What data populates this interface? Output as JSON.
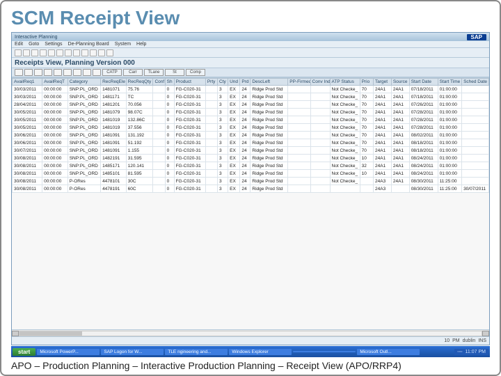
{
  "slide": {
    "title": "SCM Receipt View",
    "caption": "APO – Production Planning – Interactive Production Planning – Receipt View (APO/RRP4)"
  },
  "sap": {
    "titlebar": "Interactive Planning",
    "logo": "SAP",
    "menu": [
      "Edit",
      "Goto",
      "Settings",
      "De-Planning Board",
      "System",
      "Help"
    ],
    "view_title": "Receipts View, Planning Version 000",
    "toolbar2_labels": [
      "",
      "",
      "",
      "",
      "",
      "",
      "",
      "",
      "",
      "CATP",
      "Carr",
      "TLane",
      "St",
      "Comp"
    ],
    "status_right": [
      "10",
      "PM",
      "dublin",
      "INS"
    ]
  },
  "grid": {
    "columns": [
      "AvailReq1",
      "AvailReqT",
      "Category",
      "RecReqEle",
      "RecReqQty",
      "Conf",
      "Sh",
      "Product",
      "Prty",
      "Cty",
      "Und",
      "Prd",
      "DescLeft",
      "PP-Firmed",
      "Conv Ind",
      "ATP Status",
      "Prio",
      "Target",
      "Source",
      "Start Date",
      "Start Time",
      "Sched Date"
    ],
    "rows": [
      {
        "c": [
          "30/03/2011",
          "00:00:00",
          "SNP:PL_ORD",
          "1481071",
          "75.76",
          "",
          "0",
          "FG-C020-31",
          "",
          "3",
          "EX",
          "24",
          "Ridge Prod Std",
          "",
          "",
          "Not Checke_",
          "70",
          "24A1",
          "24A1",
          "07/18/2011",
          "01:00:00",
          ""
        ]
      },
      {
        "c": [
          "30/03/2011",
          "00:00:00",
          "SNP:PL_ORD",
          "1481171",
          "TC",
          "",
          "0",
          "FG-C020-31",
          "",
          "3",
          "EX",
          "24",
          "Ridge Prod Std",
          "",
          "",
          "Not Checke_",
          "70",
          "24A1",
          "24A1",
          "07/18/2011",
          "01:00:00",
          ""
        ]
      },
      {
        "c": [
          "28/04/2011",
          "00:00:00",
          "SNP:PL_ORD",
          "1481201",
          "70.056",
          "",
          "0",
          "FG-C020-31",
          "",
          "3",
          "EX",
          "24",
          "Ridge Prod Std",
          "",
          "",
          "Not Checke_",
          "70",
          "24A1",
          "24A1",
          "07/26/2011",
          "01:00:00",
          ""
        ]
      },
      {
        "c": [
          "30/05/2011",
          "00:00:00",
          "SNP:PL_ORD",
          "1481079",
          "98.07C",
          "",
          "0",
          "FG-C020-31",
          "",
          "3",
          "EX",
          "24",
          "Ridge Prod Std",
          "",
          "",
          "Not Checke_",
          "70",
          "24A1",
          "24A1",
          "07/28/2011",
          "01:00:00",
          ""
        ]
      },
      {
        "c": [
          "30/05/2011",
          "00:00:00",
          "SNP:PL_ORD",
          "1481019",
          "132.86C",
          "",
          "0",
          "FG-C020-31",
          "",
          "3",
          "EX",
          "24",
          "Ridge Prod Std",
          "",
          "",
          "Not Checke_",
          "70",
          "24A1",
          "24A1",
          "07/28/2011",
          "01:00:00",
          ""
        ]
      },
      {
        "c": [
          "30/05/2011",
          "00:00:00",
          "SNP:PL_ORD",
          "1481019",
          "37.556",
          "",
          "0",
          "FG-C020-31",
          "",
          "3",
          "EX",
          "24",
          "Ridge Prod Std",
          "",
          "",
          "Not Checke_",
          "70",
          "24A1",
          "24A1",
          "07/28/2011",
          "01:00:00",
          ""
        ]
      },
      {
        "c": [
          "30/06/2011",
          "00:00:00",
          "SNP:PL_ORD",
          "1481091",
          "131.192",
          "",
          "0",
          "FG-C020-31",
          "",
          "3",
          "EX",
          "24",
          "Ridge Prod Std",
          "",
          "",
          "Not Checke_",
          "70",
          "24A1",
          "24A1",
          "08/02/2011",
          "01:00:00",
          ""
        ]
      },
      {
        "c": [
          "30/06/2011",
          "00:00:00",
          "SNP:PL_ORD",
          "1481091",
          "51.192",
          "",
          "0",
          "FG-C020-31",
          "",
          "3",
          "EX",
          "24",
          "Ridge Prod Std",
          "",
          "",
          "Not Checke_",
          "70",
          "24A1",
          "24A1",
          "08/18/2011",
          "01:00:00",
          ""
        ]
      },
      {
        "c": [
          "30/07/2011",
          "00:00:00",
          "SNP:PL_ORD",
          "1481091",
          "1.155",
          "",
          "0",
          "FG-C020-31",
          "",
          "3",
          "EX",
          "24",
          "Ridge Prod Std",
          "",
          "",
          "Not Checke_",
          "70",
          "24A1",
          "24A1",
          "08/18/2011",
          "01:00:00",
          ""
        ]
      },
      {
        "c": [
          "30/08/2011",
          "00:00:00",
          "SNP:PL_ORD",
          "1482191",
          "31.595",
          "",
          "0",
          "FG-C020-31",
          "",
          "3",
          "EX",
          "24",
          "Ridge Prod Std",
          "",
          "",
          "Not Checke_",
          "10",
          "24A1",
          "24A1",
          "08/24/2011",
          "01:00:00",
          ""
        ]
      },
      {
        "c": [
          "30/08/2011",
          "00:00:00",
          "SNP:PL_ORD",
          "1485171",
          "120.141",
          "",
          "0",
          "FG-C020-31",
          "",
          "3",
          "EX",
          "24",
          "Ridge Prod Std",
          "",
          "",
          "Not Checke_",
          "32",
          "24A1",
          "24A1",
          "08/24/2011",
          "01:00:00",
          ""
        ]
      },
      {
        "c": [
          "30/08/2011",
          "00:00:00",
          "SNP:PL_ORD",
          "1485101",
          "81.595",
          "",
          "0",
          "FG-C020-31",
          "",
          "3",
          "EX",
          "24",
          "Ridge Prod Std",
          "",
          "",
          "Not Checke_",
          "10",
          "24A1",
          "24A1",
          "08/24/2011",
          "01:00:00",
          ""
        ]
      },
      {
        "c": [
          "30/08/2011",
          "00:00:00",
          "P-ORes",
          "4478101",
          "30C",
          "",
          "0",
          "FG-C020-31",
          "",
          "3",
          "EX",
          "24",
          "Ridge Prod Std",
          "",
          "",
          "Not Checke_",
          "",
          "24A3",
          "24A1",
          "08/30/2011",
          "11:25:00",
          ""
        ]
      },
      {
        "c": [
          "30/08/2011",
          "00:00:00",
          "P-ORes",
          "4478191",
          "60C",
          "",
          "0",
          "FG-C020-31",
          "",
          "3",
          "EX",
          "24",
          "Ridge Prod Std",
          "",
          "",
          "",
          "",
          "24A3",
          "",
          "08/30/2011",
          "11:25:00",
          "30/07/2011"
        ]
      }
    ]
  },
  "taskbar": {
    "start": "start",
    "tasks": [
      "Microsoft PowerP...",
      "SAP Logon for W...",
      "TLE ngineering and...",
      "Windows Explorer",
      "",
      "Microsoft Outl..."
    ],
    "time": "11:07 PM"
  }
}
